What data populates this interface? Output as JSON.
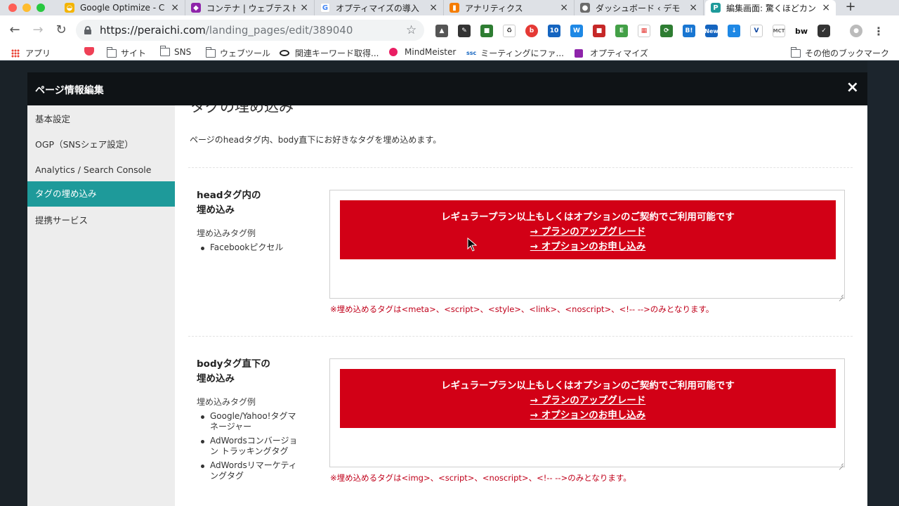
{
  "browser": {
    "tabs": [
      {
        "title": "Google Optimize - C",
        "icon": "google-optimize-icon",
        "color": "#f4b400"
      },
      {
        "title": "コンテナ | ウェブテスト",
        "icon": "optimize-container-icon",
        "color": "#8e24aa"
      },
      {
        "title": "オプティマイズの導入",
        "icon": "google-g-icon",
        "color": "#4285f4"
      },
      {
        "title": "アナリティクス",
        "icon": "analytics-icon",
        "color": "#f57c00"
      },
      {
        "title": "ダッシュボード ‹ デモ",
        "icon": "avatar-icon",
        "color": "#6b6b6b"
      },
      {
        "title": "編集画面: 驚くほどカン",
        "icon": "peraichi-icon",
        "color": "#1e9a9a"
      }
    ],
    "url_host": "https://peraichi.com",
    "url_path": "/landing_pages/edit/389040",
    "bookmarks": [
      {
        "label": "アプリ",
        "icon": "apps-grid-icon"
      },
      {
        "label": "",
        "icon": "pocket-icon"
      },
      {
        "label": "サイト",
        "icon": "folder-icon"
      },
      {
        "label": "SNS",
        "icon": "folder-icon"
      },
      {
        "label": "ウェブツール",
        "icon": "folder-icon"
      },
      {
        "label": "関連キーワード取得...",
        "icon": "eye-icon"
      },
      {
        "label": "MindMeister",
        "icon": "mindmeister-icon"
      },
      {
        "label": "ミーティングにファ...",
        "icon": "ssc-icon"
      },
      {
        "label": "オプティマイズ",
        "icon": "optimize-icon"
      }
    ],
    "other_bookmarks": "その他のブックマーク"
  },
  "modal": {
    "title": "ページ情報編集",
    "close": "×",
    "sidebar": [
      {
        "label": "基本設定"
      },
      {
        "label": "OGP（SNSシェア設定）"
      },
      {
        "label": "Analytics / Search Console"
      },
      {
        "label": "タグの埋め込み",
        "active": true
      },
      {
        "label": "提携サービス"
      }
    ],
    "section_title": "タグの埋め込み",
    "description": "ページのheadタグ内、body直下にお好きなタグを埋め込めます。",
    "head": {
      "label_line1": "headタグ内の",
      "label_line2": "埋め込み",
      "examples_label": "埋め込みタグ例",
      "examples": [
        "Facebookピクセル"
      ],
      "banner_line1": "レギュラープラン以上もしくはオプションのご契約でご利用可能です",
      "banner_link1": "→ プランのアップグレード",
      "banner_link2": "→ オプションのお申し込み",
      "note": "※埋め込めるタグは<meta>、<script>、<style>、<link>、<noscript>、<!-- -->のみとなります。"
    },
    "body": {
      "label_line1": "bodyタグ直下の",
      "label_line2": "埋め込み",
      "examples_label": "埋め込みタグ例",
      "examples": [
        "Google/Yahoo!タグマネージャー",
        "AdWordsコンバージョン トラッキングタグ",
        "AdWordsリマーケティングタグ"
      ],
      "banner_line1": "レギュラープラン以上もしくはオプションのご契約でご利用可能です",
      "banner_link1": "→ プランのアップグレード",
      "banner_link2": "→ オプションのお申し込み",
      "note": "※埋め込めるタグは<img>、<script>、<noscript>、<!-- -->のみとなります。"
    }
  },
  "colors": {
    "accent_teal": "#1e9a9a",
    "banner_red": "#d20016",
    "note_red": "#c0001a",
    "modal_header": "#0f1316"
  }
}
